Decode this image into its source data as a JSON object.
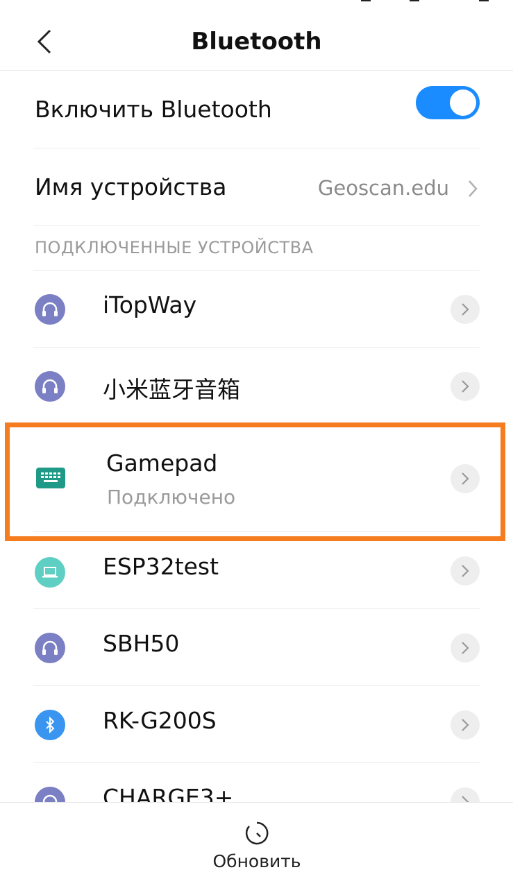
{
  "header": {
    "title": "Bluetooth"
  },
  "bluetooth_toggle": {
    "label": "Включить Bluetooth",
    "state": "on",
    "accent": "#1a8cff"
  },
  "device_name": {
    "label": "Имя устройства",
    "value": "Geoscan.edu"
  },
  "section": {
    "title": "ПОДКЛЮЧЕННЫЕ УСТРОЙСТВА"
  },
  "devices": [
    {
      "name": "iTopWay",
      "icon": "headset-icon",
      "color": "#7b7fc4"
    },
    {
      "name": "小米蓝牙音箱",
      "icon": "headset-icon",
      "color": "#7b7fc4"
    },
    {
      "name": "Gamepad",
      "status": "Подключено",
      "icon": "keyboard-icon",
      "color": "#1e9a86"
    },
    {
      "name": "ESP32test",
      "icon": "laptop-icon",
      "color": "#5fcfc4"
    },
    {
      "name": "SBH50",
      "icon": "headset-icon",
      "color": "#7b7fc4"
    },
    {
      "name": "RK-G200S",
      "icon": "bluetooth-icon",
      "color": "#3a95f0"
    },
    {
      "name": "CHARGE3+",
      "icon": "headset-icon",
      "color": "#7b7fc4"
    }
  ],
  "highlight": {
    "color": "#f57c1f"
  },
  "bottom": {
    "refresh_label": "Обновить"
  }
}
